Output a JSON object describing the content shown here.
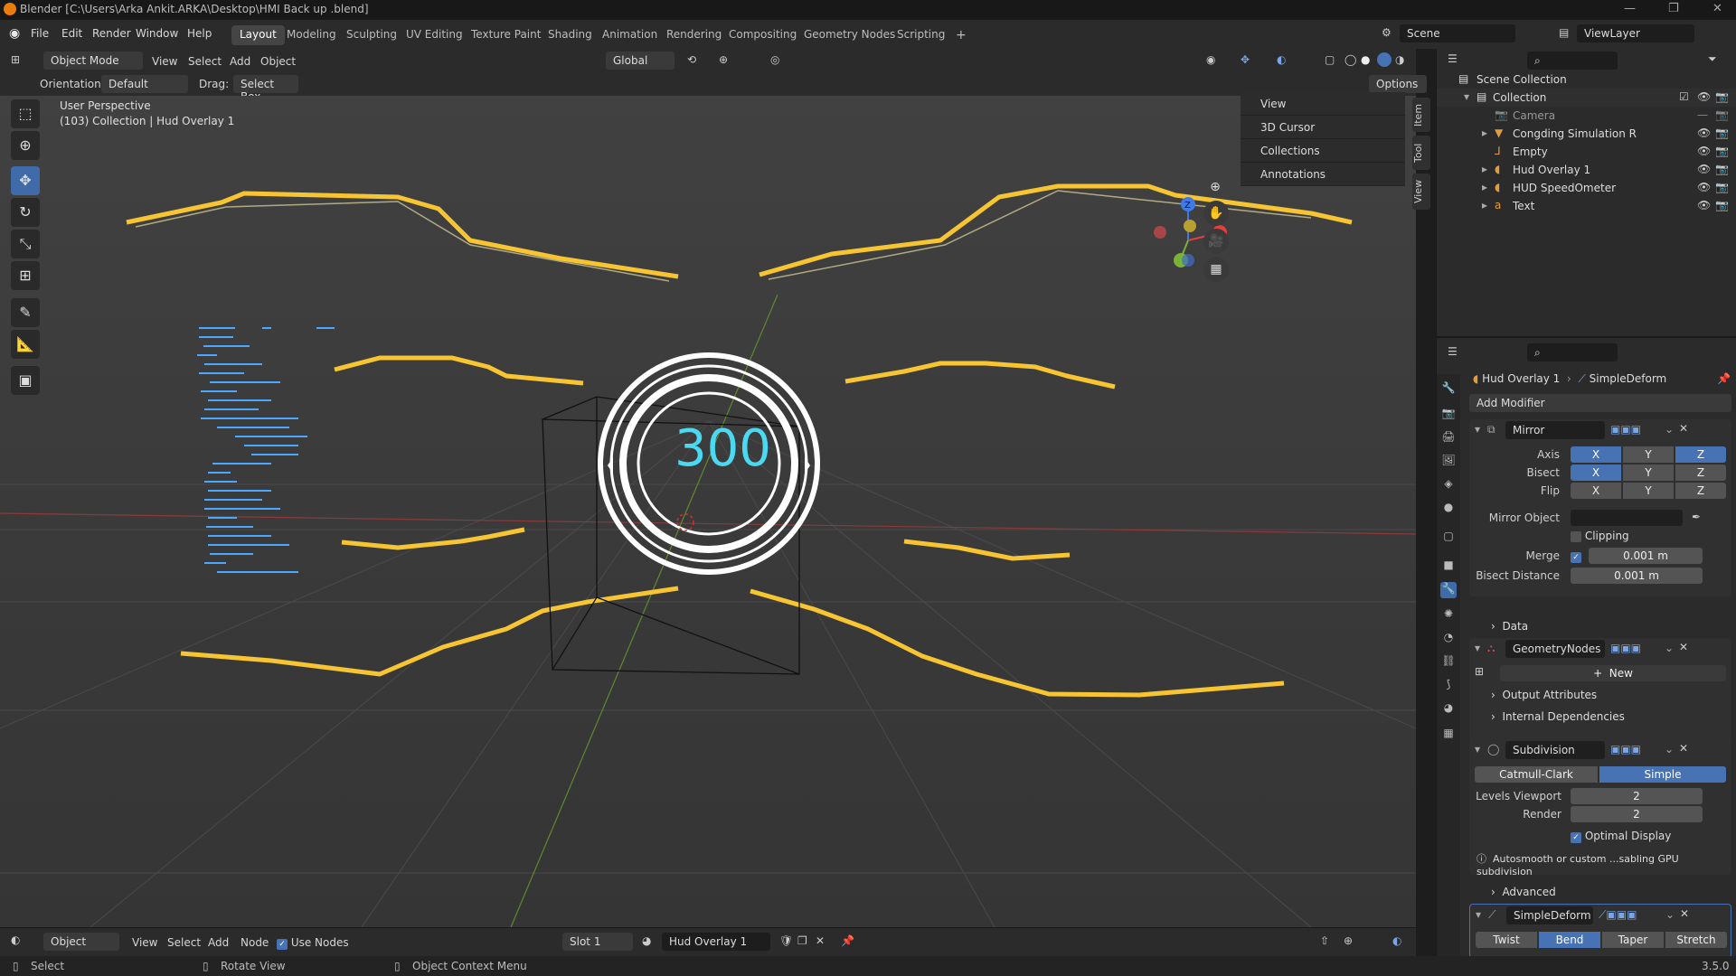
{
  "window": {
    "title": "Blender [C:\\Users\\Arka Ankit.ARKA\\Desktop\\HMI Back up .blend]",
    "version": "3.5.0"
  },
  "menu": [
    "File",
    "Edit",
    "Render",
    "Window",
    "Help"
  ],
  "workspaces": [
    "Layout",
    "Modeling",
    "Sculpting",
    "UV Editing",
    "Texture Paint",
    "Shading",
    "Animation",
    "Rendering",
    "Compositing",
    "Geometry Nodes",
    "Scripting"
  ],
  "scene": {
    "scene_name": "Scene",
    "view_layer": "ViewLayer"
  },
  "viewport_header": {
    "mode": "Object Mode",
    "menus": [
      "View",
      "Select",
      "Add",
      "Object"
    ],
    "transform": "Global",
    "orientation_label": "Orientation:",
    "orientation": "Default",
    "drag_label": "Drag:",
    "drag": "Select Box",
    "options": "Options"
  },
  "viewport": {
    "perspective": "User Perspective",
    "collection_info": "(103) Collection | Hud Overlay 1",
    "speed_value": "300",
    "n_panel": [
      "View",
      "3D Cursor",
      "Collections",
      "Annotations"
    ],
    "side_tabs": [
      "Item",
      "Tool",
      "View"
    ],
    "gizmo_axes": [
      "X",
      "Y",
      "Z"
    ]
  },
  "outliner": {
    "root": "Scene Collection",
    "collection": "Collection",
    "items": [
      "Camera",
      "Congding Simulation R",
      "Empty",
      "Hud Overlay 1",
      "HUD SpeedOmeter",
      "Text"
    ]
  },
  "properties": {
    "breadcrumb_object": "Hud Overlay 1",
    "breadcrumb_modifier": "SimpleDeform",
    "add_modifier": "Add Modifier",
    "mirror": {
      "name": "Mirror",
      "axis_label": "Axis",
      "bisect_label": "Bisect",
      "flip_label": "Flip",
      "axes": [
        "X",
        "Y",
        "Z"
      ],
      "mirror_object_label": "Mirror Object",
      "clipping": "Clipping",
      "merge_label": "Merge",
      "merge_value": "0.001 m",
      "bisect_distance_label": "Bisect Distance",
      "bisect_distance_value": "0.001 m",
      "data": "Data"
    },
    "geometry_nodes": {
      "name": "GeometryNodes",
      "new": "New",
      "output_attributes": "Output Attributes",
      "internal_dependencies": "Internal Dependencies"
    },
    "subdivision": {
      "name": "Subdivision",
      "types": [
        "Catmull-Clark",
        "Simple"
      ],
      "levels_viewport_label": "Levels Viewport",
      "levels_viewport": "2",
      "render_label": "Render",
      "render": "2",
      "optimal_display": "Optimal Display",
      "warning": "Autosmooth or custom ...sabling GPU subdivision",
      "advanced": "Advanced"
    },
    "simple_deform": {
      "name": "SimpleDeform",
      "types": [
        "Twist",
        "Bend",
        "Taper",
        "Stretch"
      ]
    }
  },
  "bottom_header": {
    "editor": "Object",
    "menus": [
      "View",
      "Select",
      "Add",
      "Node"
    ],
    "use_nodes": "Use Nodes",
    "slot": "Slot 1",
    "material": "Hud Overlay 1"
  },
  "status": {
    "select": "Select",
    "rotate": "Rotate View",
    "context": "Object Context Menu"
  },
  "colors": {
    "hud_yellow": "#f7c531",
    "hud_cyan": "#4ad9f0",
    "accent_blue": "#4772b3"
  }
}
